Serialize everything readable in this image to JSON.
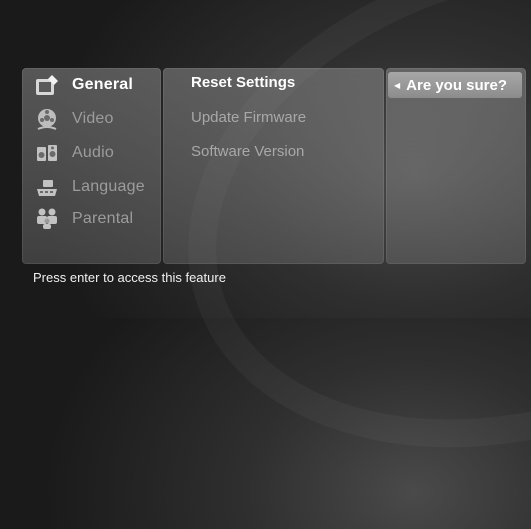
{
  "categories": [
    {
      "label": "General",
      "icon": "settings-wrench-icon",
      "active": true
    },
    {
      "label": "Video",
      "icon": "film-reel-icon",
      "active": false
    },
    {
      "label": "Audio",
      "icon": "speaker-icon",
      "active": false
    },
    {
      "label": "Language",
      "icon": "keyboard-icon",
      "active": false
    },
    {
      "label": "Parental",
      "icon": "parental-family-icon",
      "active": false
    }
  ],
  "options": [
    {
      "label": "Reset Settings",
      "active": true
    },
    {
      "label": "Update Firmware",
      "active": false
    },
    {
      "label": "Software Version",
      "active": false
    }
  ],
  "confirm": {
    "label": "Are you sure?",
    "icon": "left-arrow-icon"
  },
  "status_text": "Press enter to access this feature",
  "colors": {
    "active_text": "#ffffff",
    "inactive_text": "#9c9c9c",
    "highlight": "#9a9a9a"
  }
}
